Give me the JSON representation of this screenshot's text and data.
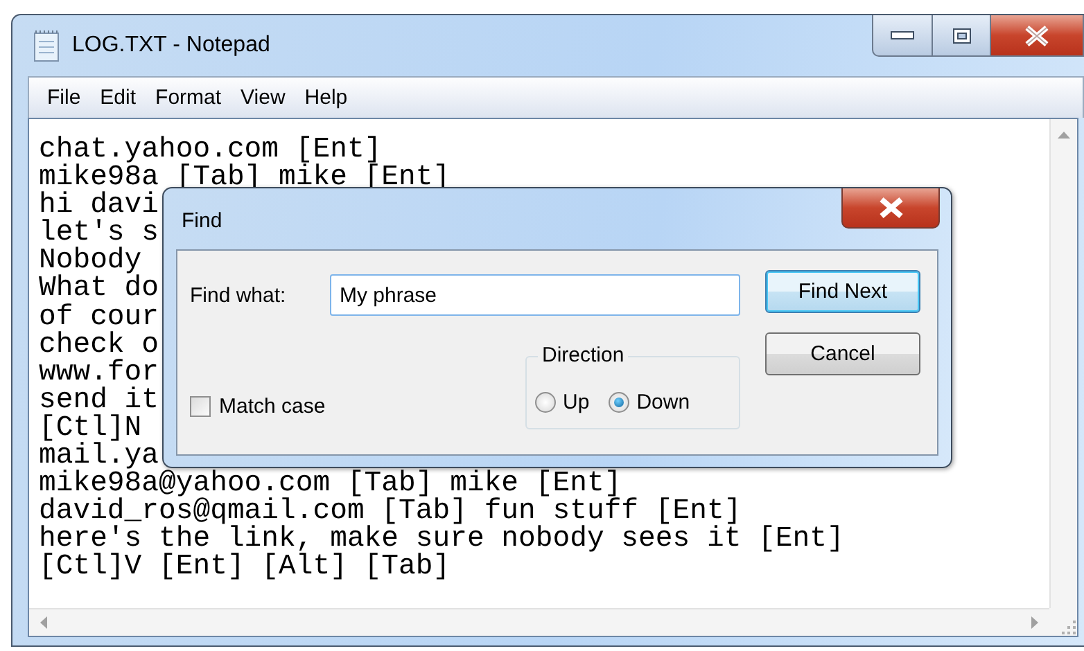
{
  "window": {
    "title": "LOG.TXT - Notepad"
  },
  "menu": [
    {
      "label": "File"
    },
    {
      "label": "Edit"
    },
    {
      "label": "Format"
    },
    {
      "label": "View"
    },
    {
      "label": "Help"
    }
  ],
  "text_lines": [
    "chat.yahoo.com [Ent]",
    "mike98a [Tab] mike [Ent]",
    "hi davi",
    "let's s",
    "Nobody",
    "What do",
    "of cour",
    "check o",
    "www.for",
    "send it",
    "[Ctl]N",
    "mail.ya",
    "mike98a@yahoo.com [Tab] mike [Ent]",
    "david_ros@qmail.com [Tab] fun stuff [Ent]",
    "here's the link, make sure nobody sees it [Ent]",
    "[Ctl]V [Ent] [Alt] [Tab]"
  ],
  "find_dialog": {
    "title": "Find",
    "find_what_label": "Find what:",
    "find_what_value": "My phrase",
    "match_case": {
      "label": "Match case",
      "checked": false
    },
    "direction": {
      "label": "Direction",
      "options": [
        {
          "label": "Up",
          "selected": false
        },
        {
          "label": "Down",
          "selected": true
        }
      ]
    },
    "buttons": [
      {
        "label": "Find Next",
        "default": true
      },
      {
        "label": "Cancel",
        "default": false
      }
    ]
  }
}
